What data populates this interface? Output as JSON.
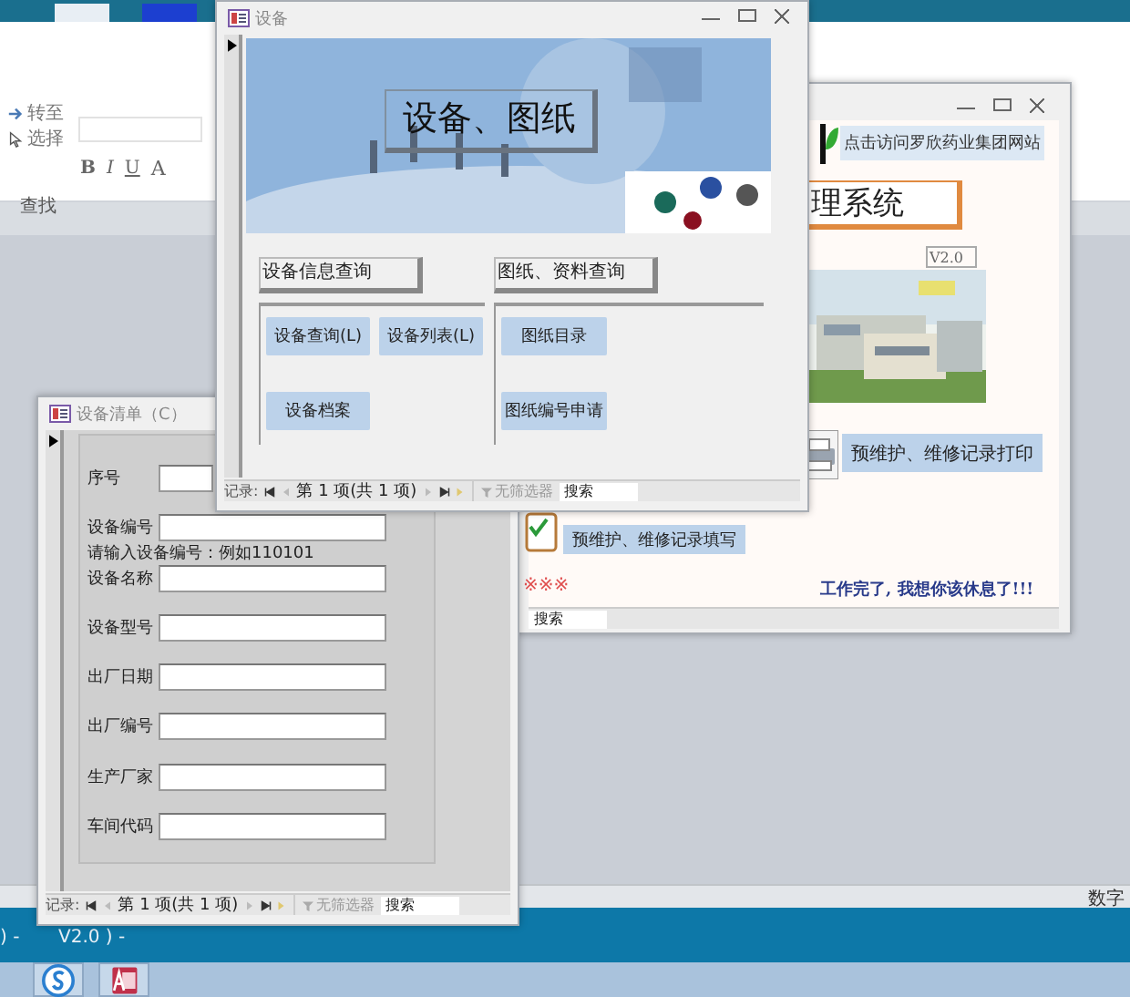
{
  "ribbon": {
    "commands": [
      {
        "label": "转至",
        "kind": "goto"
      },
      {
        "label": "选择",
        "kind": "select"
      }
    ],
    "format_buttons": [
      "B",
      "I",
      "U",
      "A"
    ],
    "group_label": "查找"
  },
  "main_window": {
    "link": "点击访问罗欣药业集团网站",
    "title_fragment": "理系统",
    "version": "V2.0",
    "print_button": "预维护、维修记录打印",
    "fill_button": "预维护、维修记录填写",
    "marks": "※※※",
    "message": "工作完了, 我想你该休息了!!!",
    "search": "搜索"
  },
  "equipment_window": {
    "title": "设备",
    "banner_title": "设备、图纸",
    "sections": [
      {
        "heading": "设备信息查询",
        "buttons": [
          "设备查询(L)",
          "设备列表(L)",
          "设备档案"
        ]
      },
      {
        "heading": "图纸、资料查询",
        "buttons": [
          "图纸目录",
          "图纸编号申请"
        ]
      }
    ],
    "nav": {
      "label": "记录:",
      "position": "第 1 项(共 1 项)",
      "filter": "无筛选器",
      "search": "搜索"
    }
  },
  "list_window": {
    "title": "设备清单（C）",
    "fields": [
      {
        "label": "序号"
      },
      {
        "label": "设备编号",
        "hint": "请输入设备编号：例如110101"
      },
      {
        "label": "设备名称"
      },
      {
        "label": "设备型号"
      },
      {
        "label": "出厂日期"
      },
      {
        "label": "出厂编号"
      },
      {
        "label": "生产厂家"
      },
      {
        "label": "车间代码"
      }
    ],
    "nav": {
      "label": "记录:",
      "position": "第 1 项(共 1 项)",
      "filter": "无筛选器",
      "search": "搜索"
    }
  },
  "status_bar": {
    "mode": "数字"
  },
  "caption_lines": [
    ") -",
    "V2.0 ) -"
  ]
}
